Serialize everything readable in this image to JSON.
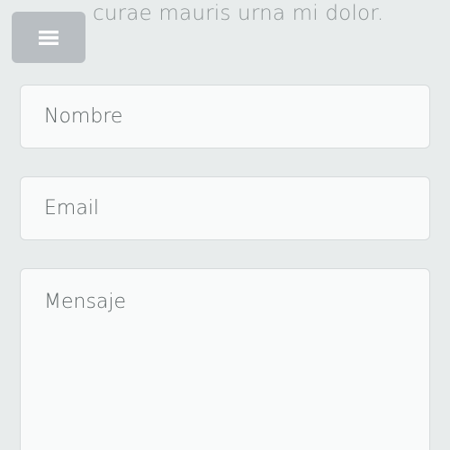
{
  "header": {
    "intro_text": "curae mauris urna mi dolor.",
    "menu_icon": "hamburger-icon"
  },
  "form": {
    "name_placeholder": "Nombre",
    "email_placeholder": "Email",
    "message_placeholder": "Mensaje"
  },
  "colors": {
    "background": "#e8ecec",
    "menu_button": "#b9bec2",
    "field_background": "#f9fafa",
    "text": "#5e6566"
  }
}
